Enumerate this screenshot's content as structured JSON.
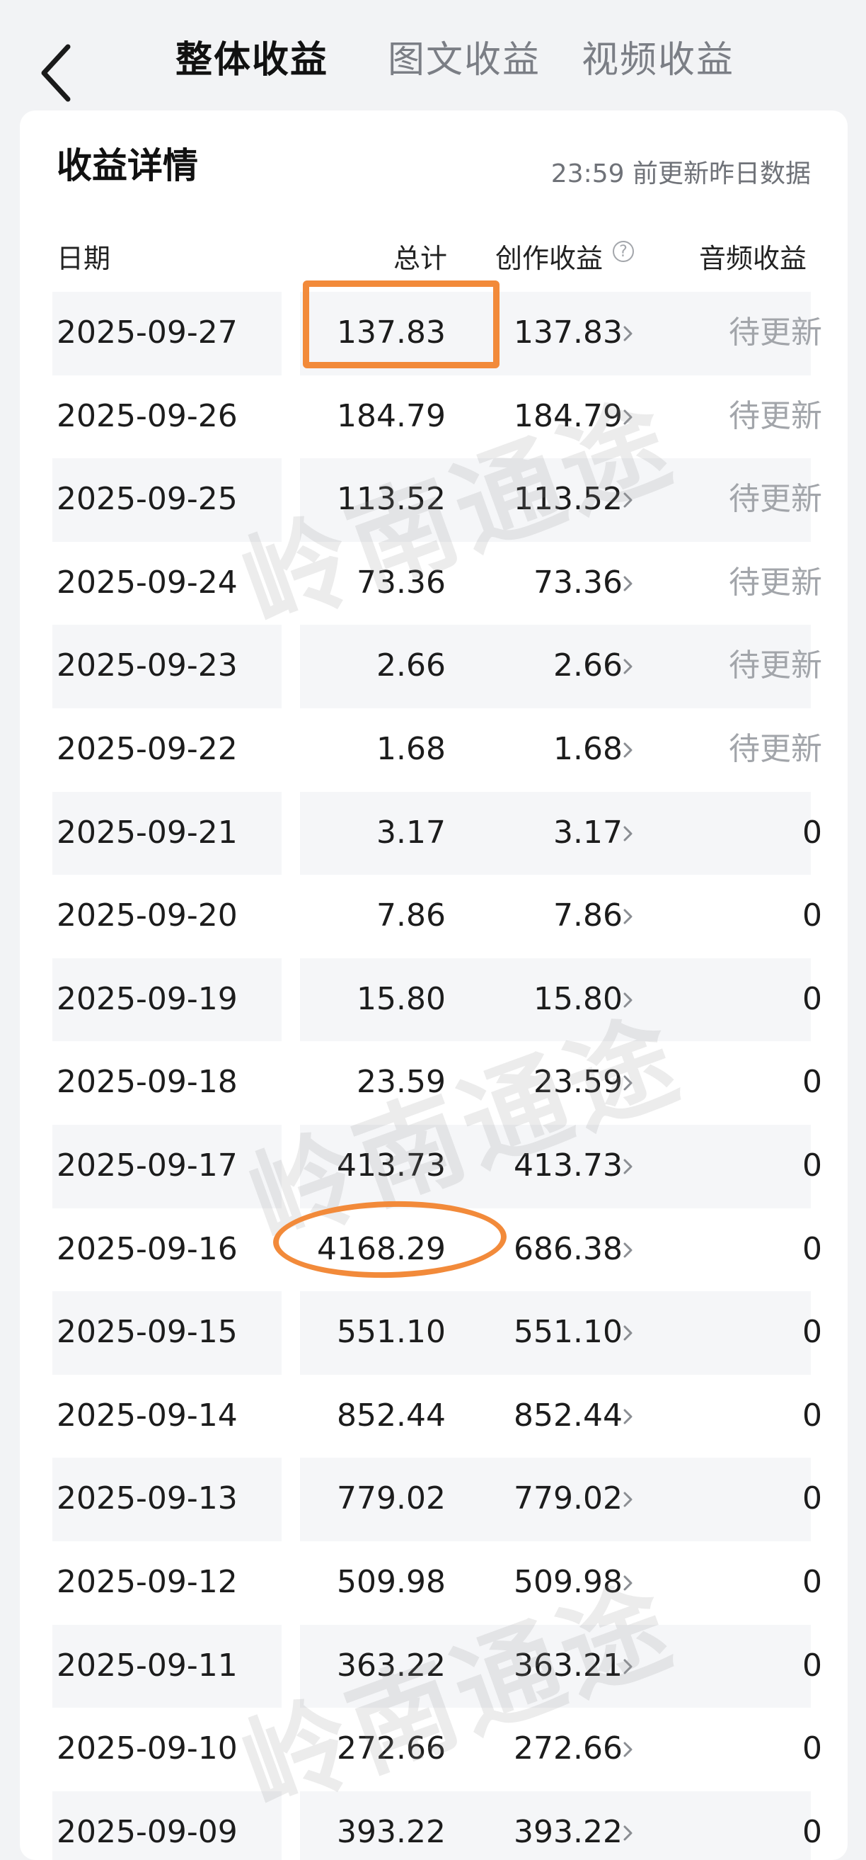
{
  "header": {
    "tabs": [
      {
        "label": "整体收益",
        "active": true
      },
      {
        "label": "图文收益",
        "active": false
      },
      {
        "label": "视频收益",
        "active": false
      }
    ]
  },
  "card": {
    "title": "收益详情",
    "update_note": "23:59 前更新昨日数据",
    "columns": {
      "date": "日期",
      "total": "总计",
      "creation": "创作收益",
      "audio": "音频收益"
    }
  },
  "rows": [
    {
      "date": "2025-09-27",
      "total": "137.83",
      "creation": "137.83",
      "audio": "待更新"
    },
    {
      "date": "2025-09-26",
      "total": "184.79",
      "creation": "184.79",
      "audio": "待更新"
    },
    {
      "date": "2025-09-25",
      "total": "113.52",
      "creation": "113.52",
      "audio": "待更新"
    },
    {
      "date": "2025-09-24",
      "total": "73.36",
      "creation": "73.36",
      "audio": "待更新"
    },
    {
      "date": "2025-09-23",
      "total": "2.66",
      "creation": "2.66",
      "audio": "待更新"
    },
    {
      "date": "2025-09-22",
      "total": "1.68",
      "creation": "1.68",
      "audio": "待更新"
    },
    {
      "date": "2025-09-21",
      "total": "3.17",
      "creation": "3.17",
      "audio": "0"
    },
    {
      "date": "2025-09-20",
      "total": "7.86",
      "creation": "7.86",
      "audio": "0"
    },
    {
      "date": "2025-09-19",
      "total": "15.80",
      "creation": "15.80",
      "audio": "0"
    },
    {
      "date": "2025-09-18",
      "total": "23.59",
      "creation": "23.59",
      "audio": "0"
    },
    {
      "date": "2025-09-17",
      "total": "413.73",
      "creation": "413.73",
      "audio": "0"
    },
    {
      "date": "2025-09-16",
      "total": "4168.29",
      "creation": "686.38",
      "audio": "0"
    },
    {
      "date": "2025-09-15",
      "total": "551.10",
      "creation": "551.10",
      "audio": "0"
    },
    {
      "date": "2025-09-14",
      "total": "852.44",
      "creation": "852.44",
      "audio": "0"
    },
    {
      "date": "2025-09-13",
      "total": "779.02",
      "creation": "779.02",
      "audio": "0"
    },
    {
      "date": "2025-09-12",
      "total": "509.98",
      "creation": "509.98",
      "audio": "0"
    },
    {
      "date": "2025-09-11",
      "total": "363.22",
      "creation": "363.21",
      "audio": "0"
    },
    {
      "date": "2025-09-10",
      "total": "272.66",
      "creation": "272.66",
      "audio": "0"
    },
    {
      "date": "2025-09-09",
      "total": "393.22",
      "creation": "393.22",
      "audio": "0"
    }
  ],
  "watermark": "岭南通途",
  "colors": {
    "highlight": "#f28a3a",
    "pending": "#a2a5aa",
    "stripe": "#f5f6f8"
  }
}
